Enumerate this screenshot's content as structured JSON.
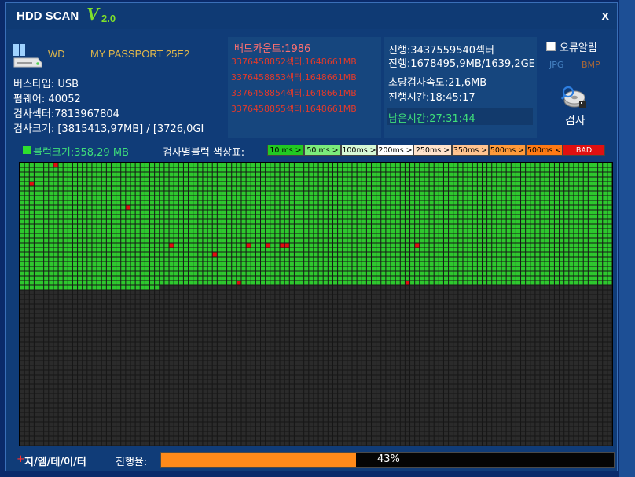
{
  "app": {
    "title": "HDD SCAN",
    "version_v": "V",
    "version": "2.0",
    "close": "x"
  },
  "drive": {
    "icon": "windows-drive-icon",
    "brand": "WD",
    "model": "MY PASSPORT 25E2",
    "bus_type": "버스타입: USB",
    "firmware": "펌웨어: 40052",
    "sectors": "검사섹터:7813967804",
    "size": "검사크기: [3815413,97MB] / [3726,0GI"
  },
  "bad": {
    "title": "배드카운트:1986",
    "lines": [
      "3376458852섹터,1648661MB",
      "3376458853섹터,1648661MB",
      "3376458854섹터,1648661MB",
      "3376458855섹터,1648661MB"
    ]
  },
  "progress_info": {
    "sector_progress": "진행:3437559540섹터",
    "mb_progress": "진행:1678495,9MB/1639,2GE",
    "speed": "초당검사속도:21,6MB",
    "elapsed": "진행시간:18:45:17",
    "remaining": "남은시간:27:31:44"
  },
  "options": {
    "error_alert_label": "오류알림",
    "error_alert_checked": false,
    "jpg": "JPG",
    "bmp": "BMP",
    "scan_label": "검사",
    "scan_icon": "scan-disk-icon"
  },
  "legend": {
    "block_size": "블럭크기:358,29 MB",
    "title": "검사별블럭 색상표:",
    "items": [
      {
        "label": "10 ms >",
        "color": "#22c922",
        "text_color": "#000000"
      },
      {
        "label": "50 ms >",
        "color": "#7bec7b",
        "text_color": "#000000"
      },
      {
        "label": "100ms >",
        "color": "#d6f8d6",
        "text_color": "#000000"
      },
      {
        "label": "200ms >",
        "color": "#ffffff",
        "text_color": "#000000"
      },
      {
        "label": "250ms >",
        "color": "#ffe3cc",
        "text_color": "#000000"
      },
      {
        "label": "350ms >",
        "color": "#ffc38f",
        "text_color": "#000000"
      },
      {
        "label": "500ms >",
        "color": "#ff9a3a",
        "text_color": "#000000"
      },
      {
        "label": "500ms <",
        "color": "#ff7a14",
        "text_color": "#000000"
      },
      {
        "label": "BAD",
        "color": "#e01010",
        "text_color": "#ffffff"
      }
    ]
  },
  "scan_map": {
    "columns": 123,
    "rows": 60,
    "scanned_full_rows": 26,
    "scanned_partial_cols": 29,
    "scanned_color": "#2ec82e",
    "unscanned_color": "#2b2b2b",
    "bad_color": "#e01010",
    "bad_blocks": [
      [
        0,
        7
      ],
      [
        4,
        2
      ],
      [
        9,
        22
      ],
      [
        17,
        31
      ],
      [
        17,
        47
      ],
      [
        17,
        51
      ],
      [
        17,
        54
      ],
      [
        17,
        55
      ],
      [
        17,
        82
      ],
      [
        19,
        40
      ],
      [
        25,
        45
      ],
      [
        25,
        80
      ]
    ]
  },
  "footer": {
    "mark": "+",
    "name": "지/엠/데/이/터",
    "progress_label": "진행율:",
    "progress_value": 43,
    "progress_text": "43%"
  },
  "colors": {
    "window_bg": "#103c78",
    "panel_bg": "#16467e",
    "accent_green": "#7fe02a",
    "bad_red": "#e23a2a",
    "progress_orange": "#ff8a1a"
  }
}
